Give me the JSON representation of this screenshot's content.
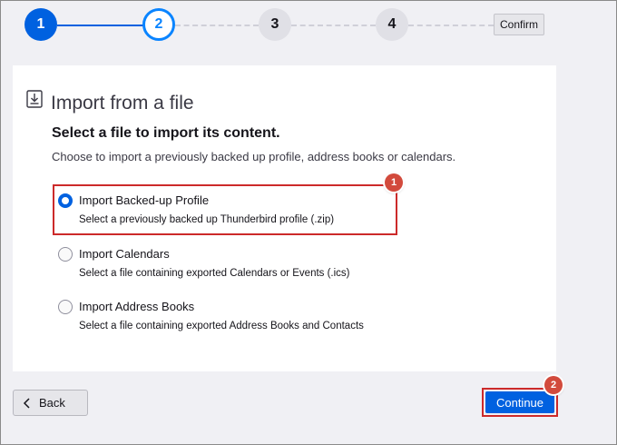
{
  "stepper": {
    "steps": [
      {
        "number": "1",
        "state": "done"
      },
      {
        "number": "2",
        "state": "current"
      },
      {
        "number": "3",
        "state": "future"
      },
      {
        "number": "4",
        "state": "future"
      }
    ],
    "confirm_label": "Confirm"
  },
  "panel": {
    "icon": "import-file-icon",
    "heading": "Import from a file",
    "subtitle": "Select a file to import its content.",
    "description": "Choose to import a previously backed up profile, address books or calendars.",
    "options": [
      {
        "label": "Import Backed-up Profile",
        "description": "Select a previously backed up Thunderbird profile (.zip)",
        "selected": true
      },
      {
        "label": "Import Calendars",
        "description": "Select a file containing exported Calendars or Events (.ics)",
        "selected": false
      },
      {
        "label": "Import Address Books",
        "description": "Select a file containing exported Address Books and Contacts",
        "selected": false
      }
    ]
  },
  "callouts": {
    "first": "1",
    "second": "2"
  },
  "footer": {
    "back_label": "Back",
    "continue_label": "Continue"
  },
  "colors": {
    "accent": "#0061e0",
    "highlight": "#cc2a2a",
    "badge": "#d24a3c"
  }
}
